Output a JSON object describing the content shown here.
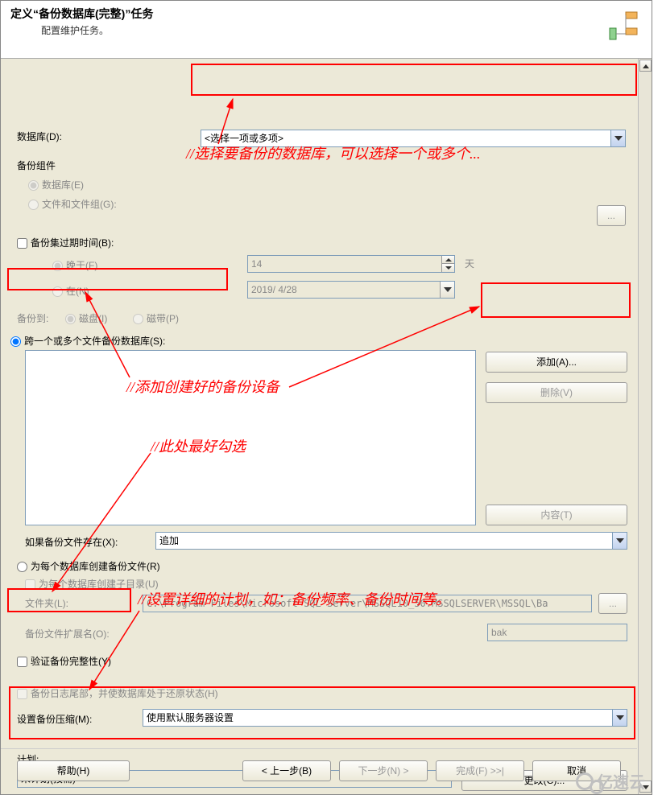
{
  "header": {
    "title": "定义“备份数据库(完整)”任务",
    "subtitle": "配置维护任务。"
  },
  "database": {
    "label": "数据库(D):",
    "placeholder": "<选择一项或多项>"
  },
  "backup_component": {
    "group_label": "备份组件",
    "opt_db": "数据库(E)",
    "opt_files": "文件和文件组(G):"
  },
  "expire": {
    "check_label": "备份集过期时间(B):",
    "after_label": "晚于(F)",
    "after_value": "14",
    "days_unit": "天",
    "at_label": "在(N)",
    "at_date": "2019/ 4/28"
  },
  "backup_to": {
    "label": "备份到:",
    "opt_disk": "磁盘(I)",
    "opt_tape": "磁带(P)"
  },
  "across": {
    "radio_label": "跨一个或多个文件备份数据库(S):",
    "add_btn": "添加(A)...",
    "remove_btn": "删除(V)",
    "content_btn": "内容(T)"
  },
  "if_exists": {
    "label": "如果备份文件存在(X):",
    "value": "追加"
  },
  "per_db": {
    "radio_label": "为每个数据库创建备份文件(R)",
    "subdir_label": "为每个数据库创建子目录(U)",
    "folder_label": "文件夹(L):",
    "folder_value": "C:\\Program Files\\Microsoft SQL Server\\MSSQL10_50.MSSQLSERVER\\MSSQL\\Ba",
    "browse_btn": "...",
    "ext_label": "备份文件扩展名(O):",
    "ext_value": "bak"
  },
  "verify": {
    "label": "验证备份完整性(Y)"
  },
  "tail": {
    "label": "备份日志尾部，并使数据库处于还原状态(H)"
  },
  "compress": {
    "label": "设置备份压缩(M):",
    "value": "使用默认服务器设置"
  },
  "schedule": {
    "label": "计划:",
    "value": "未计划(按需)",
    "change_btn": "更改(C)..."
  },
  "footer": {
    "help": "帮助(H)",
    "back": "< 上一步(B)",
    "next": "下一步(N) >",
    "finish": "完成(F) >>|",
    "cancel": "取消"
  },
  "annotations": {
    "a1": "//选择要备份的数据库，可以选择一个或多个...",
    "a2": "//添加创建好的备份设备",
    "a3": "//此处最好勾选",
    "a4": "//设置详细的计划，如：备份频率、备份时间等。"
  },
  "watermark": "亿速云"
}
